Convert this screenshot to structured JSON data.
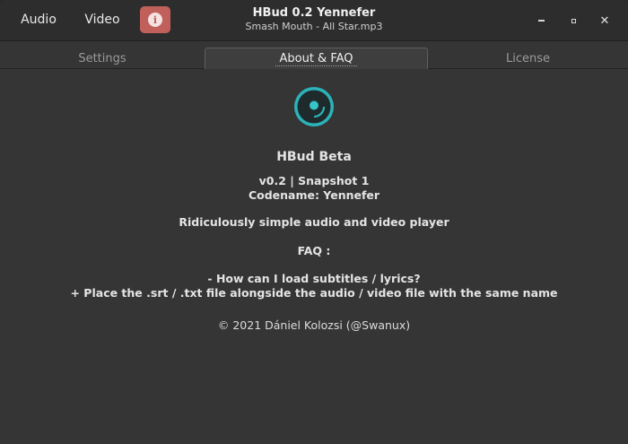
{
  "header": {
    "audio_label": "Audio",
    "video_label": "Video",
    "info_glyph": "i",
    "title": "HBud 0.2 Yennefer",
    "subtitle": "Smash Mouth - All Star.mp3",
    "close_glyph": "✕"
  },
  "tabs": [
    {
      "label": "Settings"
    },
    {
      "label": "About & FAQ",
      "active": true
    },
    {
      "label": "License"
    }
  ],
  "about": {
    "app_name": "HBud Beta",
    "version": "v0.2 | Snapshot 1",
    "codename": "Codename: Yennefer",
    "tagline": "Ridiculously simple audio and video player",
    "faq_heading": "FAQ :",
    "question_1": "- How can I load subtitles / lyrics?",
    "answer_1": "+ Place the .srt / .txt file alongside the audio / video file with the same name",
    "copyright": "© 2021 Dániel Kolozsi (@Swanux)"
  },
  "colors": {
    "accent_info": "#c1605b",
    "logo_teal": "#2ab3b8",
    "background": "#353535",
    "header": "#2d2d2d"
  },
  "icons": {
    "info": "info-icon",
    "minimize": "minimize-icon",
    "maximize": "maximize-icon",
    "close": "close-icon",
    "logo": "hbud-logo-icon"
  }
}
